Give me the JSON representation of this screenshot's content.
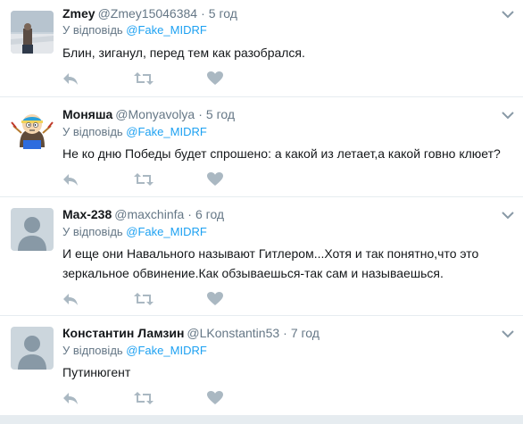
{
  "tweets": [
    {
      "name": "Zmey",
      "handle": "@Zmey15046384",
      "dot": "·",
      "time": "5 год",
      "reply_prefix": "У відповідь ",
      "reply_to": "@Fake_MIDRF",
      "text_lines": [
        "Блин, зиганул, перед тем как разобрался."
      ],
      "avatar": "photo-avatar"
    },
    {
      "name": "Моняша",
      "handle": "@Monyavolya",
      "dot": "·",
      "time": "5 год",
      "reply_prefix": "У відповідь ",
      "reply_to": "@Fake_MIDRF",
      "text_lines": [
        "Не ко дню Победы будет спрошено: а какой из летает,а какой говно клюет?"
      ],
      "avatar": "cartoon-avatar"
    },
    {
      "name": "Max-238",
      "handle": "@maxchinfa",
      "dot": "·",
      "time": "6 год",
      "reply_prefix": "У відповідь ",
      "reply_to": "@Fake_MIDRF",
      "text_lines": [
        "И еще они Навального называют Гитлером...Хотя и так понятно,что это",
        "зеркальное обвинение.Как обзываешься-так сам и называешься."
      ],
      "avatar": "default-avatar"
    },
    {
      "name": "Константин Ламзин",
      "handle": "@LKonstantin53",
      "dot": "·",
      "time": "7 год",
      "reply_prefix": "У відповідь ",
      "reply_to": "@Fake_MIDRF",
      "text_lines": [
        "Путинюгент"
      ],
      "avatar": "default-avatar"
    }
  ],
  "colors": {
    "link": "#1da1f2",
    "secondary_text": "#657786",
    "icon": "#aab8c2",
    "divider": "#e6ecf0"
  },
  "icons": {
    "reply": "reply-icon",
    "retweet": "retweet-icon",
    "like": "heart-icon",
    "menu": "chevron-down-icon"
  }
}
